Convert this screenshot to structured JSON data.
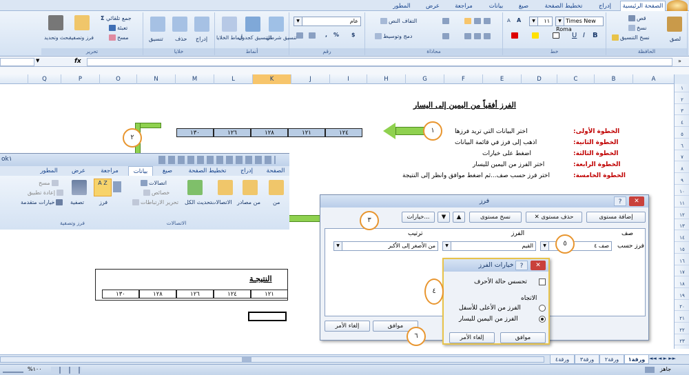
{
  "ribbon_tabs": [
    "الصفحة الرئيسية",
    "إدراج",
    "تخطيط الصفحة",
    "صيغ",
    "بيانات",
    "مراجعة",
    "عرض",
    "المطور"
  ],
  "ribbon": {
    "clipboard": {
      "label": "الحافظة",
      "paste": "لصق",
      "cut": "قص",
      "copy": "نسخ",
      "format_painter": "نسخ التنسيق"
    },
    "font": {
      "label": "خط",
      "name": "Times New Roma",
      "size": "١١",
      "bold": "B",
      "italic": "I",
      "underline": "U",
      "grow": "A",
      "shrink": "A"
    },
    "alignment": {
      "label": "محاذاة",
      "wrap": "التفاف النص",
      "merge": "دمج وتوسيط"
    },
    "number": {
      "label": "رقم",
      "format": "عام",
      "percent": "%",
      "comma": ",",
      "currency": "$"
    },
    "styles": {
      "label": "أنماط",
      "cond": "تنسيق شرطي",
      "table": "التنسيق كجدول",
      "cell": "أنماط الخلايا"
    },
    "cells": {
      "label": "خلايا",
      "insert": "إدراج",
      "delete": "حذف",
      "format": "تنسيق"
    },
    "editing": {
      "label": "تحرير",
      "autosum": "جمع تلقائي",
      "fill": "تعبئة",
      "clear": "مسح",
      "sort": "فرز وتصفية",
      "find": "بحث وتحديد"
    }
  },
  "formula_bar": {
    "fx": "fx"
  },
  "columns": [
    "A",
    "B",
    "C",
    "D",
    "E",
    "F",
    "G",
    "H",
    "I",
    "J",
    "K",
    "L",
    "M",
    "N",
    "O",
    "P",
    "Q"
  ],
  "rows": [
    "١",
    "٢",
    "٣",
    "٤",
    "٥",
    "٦",
    "٧",
    "٨",
    "٩",
    "١٠",
    "١١",
    "١٢",
    "١٣",
    "١٤",
    "١٥",
    "١٦",
    "١٧",
    "١٨",
    "١٩",
    "٢٠",
    "٢١",
    "٢٢",
    "٢٣"
  ],
  "sheet": {
    "heading": "الفرز أفقياً من اليمين إلى اليسار",
    "steps": [
      {
        "label": "الخطوة الأولى:",
        "text": "اختر البيانات التي تريد فرزها"
      },
      {
        "label": "الخطوة الثانية:",
        "text": "اذهب إلى فرز في قائمة البيانات"
      },
      {
        "label": "الخطوة الثالثة:",
        "text": "اضغط على خيارات"
      },
      {
        "label": "الخطوة الرابعة:",
        "text": "اختر الفرز من اليمين لليسار"
      },
      {
        "label": "الخطوة الخامسة:",
        "text": "اختر فرز حسب صف...ثم اضغط موافق وانظر إلى النتيجة"
      }
    ],
    "data_row": [
      "١٢٤",
      "١٢١",
      "١٢٨",
      "١٢٦",
      "١٣٠"
    ],
    "result_label": "النتيجـة",
    "result_row": [
      "١٢١",
      "١٢٤",
      "١٢٦",
      "١٢٨",
      "١٣٠"
    ]
  },
  "inset_ribbon": {
    "title": "ok١",
    "tabs": [
      "الصفحة الرئيسية",
      "إدراج",
      "تخطيط الصفحة",
      "صيغ",
      "بيانات",
      "مراجعة",
      "عرض",
      "المطور"
    ],
    "buttons": {
      "from": "من",
      "other": "من مصادر",
      "existing": "الاتصالات",
      "refresh": "تحديث الكل",
      "connections": "اتصالات",
      "properties": "خصائص",
      "edit_links": "تحرير الارتباطات",
      "sort": "فرز",
      "filter": "تصفية",
      "clear": "مسح",
      "reapply": "إعادة تطبيق",
      "advanced": "خيارات متقدمة"
    },
    "groups": {
      "connections": "الاتصالات",
      "sort_filter": "فرز وتصفية"
    }
  },
  "sort_dialog": {
    "title": "فرز",
    "add_level": "إضافة مستوى",
    "delete_level": "حذف مستوى",
    "copy_level": "نسخ مستوى",
    "options": "خيارات...",
    "col_header": "صف",
    "sort_on_header": "الفرز",
    "order_header": "ترتيب",
    "row_label": "فرز حسب",
    "row_value": "صف ٤",
    "sort_on_value": "القيم",
    "order_value": "من الأصغر إلى الأكبر",
    "ok": "موافق",
    "cancel": "إلغاء الأمر"
  },
  "options_dialog": {
    "title": "خيارات الفرز",
    "case_sensitive": "تحسس حالة الأحرف",
    "orientation": "الاتجاه",
    "top_to_bottom": "الفرز من الأعلى للأسفل",
    "left_to_right": "الفرز من اليمين لليسار",
    "ok": "موافق",
    "cancel": "إلغاء الأمر"
  },
  "callouts": [
    "١",
    "٢",
    "٣",
    "٤",
    "٥",
    "٦"
  ],
  "sheet_tabs": [
    "ورقة١",
    "ورقة٢",
    "ورقة٣",
    "ورقة٤"
  ],
  "status": {
    "ready": "جاهز",
    "zoom": "%١٠٠"
  },
  "colors": {
    "accent": "#e8952e",
    "arrow_green": "#8fd14f",
    "ribbon_blue": "#dbe6f4",
    "label_red": "#c00000"
  }
}
